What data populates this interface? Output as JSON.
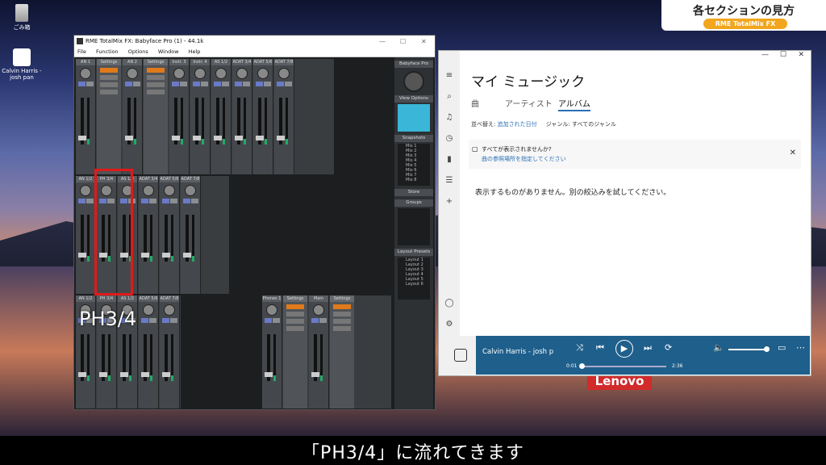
{
  "desktop": {
    "recycle_label": "ごみ箱",
    "music_icon_label": "Calvin Harris - josh pan"
  },
  "badge": {
    "title": "各セクションの見方",
    "subtitle": "RME TotalMix FX"
  },
  "caption": "「PH3/4」に流れてきます",
  "annotation": "PH3/4",
  "lenovo": "Lenovo",
  "totalmix": {
    "title": "RME TotalMix FX: Babyface Pro (1) - 44.1k",
    "menu": [
      "File",
      "Function",
      "Options",
      "Window",
      "Help"
    ],
    "row1": [
      "AN 1",
      "Settings",
      "AN 2",
      "Settings",
      "Instr. 3",
      "Instr. 4",
      "AS 1/2",
      "ADAT 3/4",
      "ADAT 5/6",
      "ADAT 7/8"
    ],
    "row2": [
      "AN 1/2",
      "PH 3/4",
      "AS 1/2",
      "ADAT 3/4",
      "ADAT 5/6",
      "ADAT 7/8"
    ],
    "row3": [
      "AN 1/2",
      "PH 3/4",
      "AS 1/2",
      "ADAT 5/6",
      "ADAT 7/8"
    ],
    "row4": [
      "Phones 1",
      "Settings",
      "Main",
      "Settings"
    ],
    "right": {
      "device": "Babyface Pro",
      "view_options": "View Options",
      "snapshots": "Snapshots",
      "snapshot_items": [
        "Mix 1",
        "Mix 2",
        "Mix 3",
        "Mix 4",
        "Mix 5",
        "Mix 6",
        "Mix 7",
        "Mix 8"
      ],
      "store": "Store",
      "groups": "Groups",
      "layout_presets": "Layout Presets",
      "layout_items": [
        "Layout 1",
        "Layout 2",
        "Layout 3",
        "Layout 4",
        "Layout 5",
        "Layout 6"
      ]
    }
  },
  "music": {
    "title": "マイ ミュージック",
    "tabs": [
      "曲",
      "アーティスト",
      "アルバム"
    ],
    "sort_label": "並べ替え:",
    "sort_value": "追加された日付",
    "genre_label": "ジャンル:",
    "genre_value": "すべてのジャンル",
    "notice_line1": "すべてが表示されませんか?",
    "notice_line2": "曲の参照場所を指定してください",
    "empty": "表示するものがありません。別の絞込みを試してください。",
    "player": {
      "track": "Calvin Harris - josh p",
      "elapsed": "0:01",
      "total": "2:36"
    }
  }
}
